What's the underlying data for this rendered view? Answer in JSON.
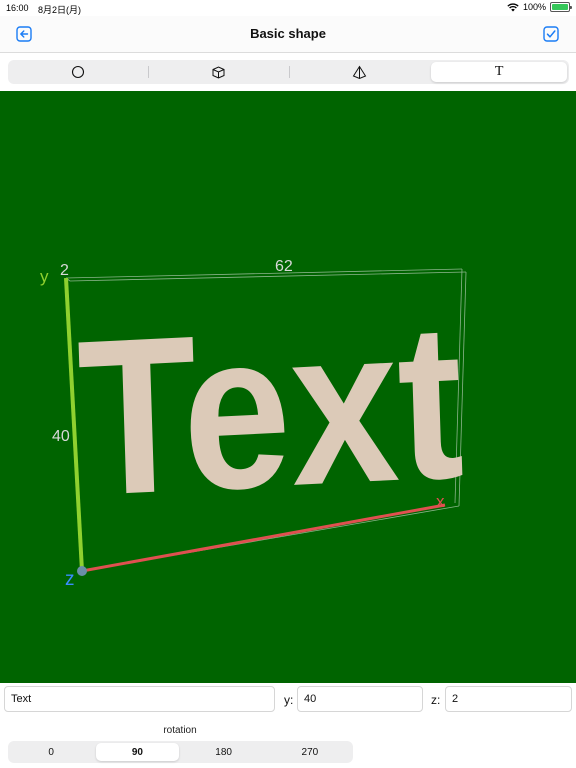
{
  "status_bar": {
    "time": "16:00",
    "date": "8月2日(月)",
    "battery": "100%"
  },
  "nav": {
    "title": "Basic shape",
    "back_icon": "arrow-left-square-icon",
    "done_icon": "checkmark-square-icon"
  },
  "shape_picker": {
    "items": [
      {
        "icon": "circle-icon"
      },
      {
        "icon": "cube-icon"
      },
      {
        "icon": "pyramid-icon"
      },
      {
        "icon": "text-icon",
        "glyph": "T"
      }
    ],
    "selected_index": 3
  },
  "viewport": {
    "background": "#006400",
    "text_color": "#dccab8",
    "text": "Text",
    "axis_labels": {
      "y": "y",
      "x": "x",
      "z": "z"
    },
    "dimension_labels": {
      "depth": "2",
      "width": "62",
      "height": "40"
    },
    "axis_colors": {
      "x": "#e05050",
      "y": "#8fd12f",
      "z": "#3a8cff"
    }
  },
  "fields": {
    "text_value": "Text",
    "y_label": "y:",
    "y_value": "40",
    "z_label": "z:",
    "z_value": "2"
  },
  "rotation": {
    "label": "rotation",
    "options": [
      "0",
      "90",
      "180",
      "270"
    ],
    "selected_index": 1
  }
}
